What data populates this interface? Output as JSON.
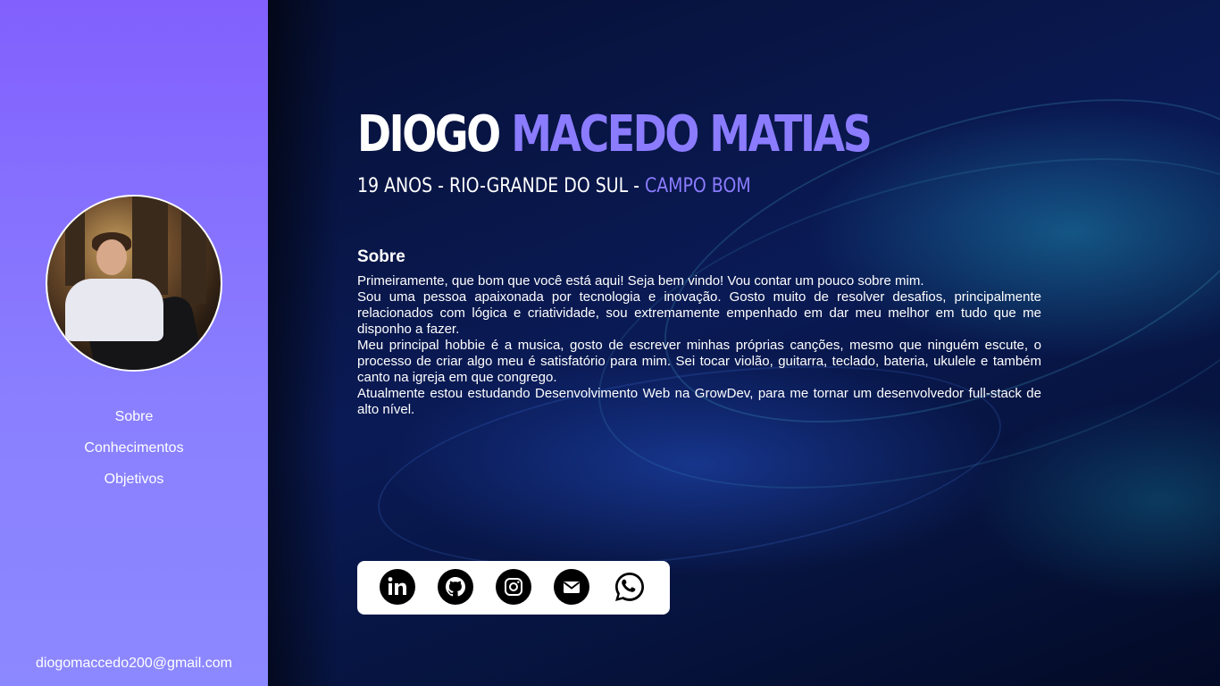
{
  "sidebar": {
    "avatar_alt": "Diogo Macedo Matias",
    "nav": [
      {
        "label": "Sobre"
      },
      {
        "label": "Conhecimentos"
      },
      {
        "label": "Objetivos"
      }
    ],
    "email": "diogomaccedo200@gmail.com"
  },
  "header": {
    "first_name": "DIOGO",
    "last_name": "MACEDO MATIAS",
    "subtitle_main": "19 ANOS - RIO-GRANDE DO SUL -",
    "subtitle_city": "CAMPO BOM"
  },
  "about": {
    "heading": "Sobre",
    "paragraphs": [
      "Primeiramente, que bom que você está aqui! Seja bem vindo! Vou contar um pouco sobre mim.",
      "Sou uma pessoa apaixonada por tecnologia e inovação. Gosto muito de resolver desafios, principalmente relacionados com lógica e criatividade, sou extremamente empenhado em dar meu melhor em tudo que me disponho a fazer.",
      "Meu principal hobbie é a musica, gosto de escrever minhas próprias canções, mesmo que ninguém escute, o processo de criar algo meu é satisfatório para mim. Sei tocar violão, guitarra, teclado, bateria, ukulele e também canto na igreja em que congrego.",
      "Atualmente estou estudando Desenvolvimento Web na GrowDev, para me tornar um desenvolvedor full-stack de alto nível."
    ]
  },
  "social": [
    {
      "name": "linkedin-icon"
    },
    {
      "name": "github-icon"
    },
    {
      "name": "instagram-icon"
    },
    {
      "name": "email-icon"
    },
    {
      "name": "whatsapp-icon"
    }
  ],
  "colors": {
    "sidebar": "#8260fd",
    "accent": "#8b7cff",
    "background": "#061035"
  }
}
